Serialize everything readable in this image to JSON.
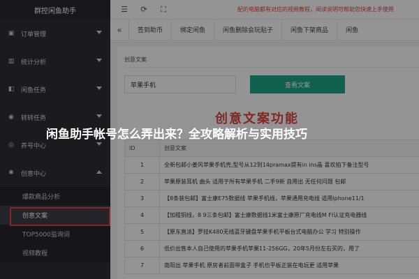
{
  "app": {
    "brand": "群控闲鱼助手"
  },
  "topbar": {
    "notice": "配的电脑都有对应的视频教程，阅读说明可帮助您快速上手使用"
  },
  "sidebar": {
    "items": [
      {
        "label": "订单管理",
        "icon": "order-icon"
      },
      {
        "label": "统计分析",
        "icon": "chart-icon"
      },
      {
        "label": "闲鱼任务",
        "icon": "task-icon"
      },
      {
        "label": "转转任务",
        "icon": "transfer-icon"
      },
      {
        "label": "养号中心",
        "icon": "account-icon"
      },
      {
        "label": "创意中心",
        "icon": "idea-icon"
      }
    ],
    "sub_items": [
      {
        "label": "爆款商品分析",
        "active": false
      },
      {
        "label": "创意文案",
        "active": true
      },
      {
        "label": "TOP5000监询词",
        "active": false
      },
      {
        "label": "视频教程",
        "active": false
      }
    ]
  },
  "tabs": [
    "签到助币",
    "绑定闲鱼",
    "闲鱼删除会玩贴子",
    "闲鱼下架商品",
    "闲鱼"
  ],
  "content": {
    "section_title": "创意文案",
    "keyword_value": "苹果手机",
    "query_button": "查看文案",
    "big_title": "创意文案功能",
    "table": {
      "headers": [
        "ID",
        "创意文案"
      ],
      "rows": [
        {
          "id": "1",
          "text": "全新包邮小姜风苹果手机壳,型号从12到14pramax提有in ins晶 喜欢拍下备注型号"
        },
        {
          "id": "2",
          "text": "苹果原装耳机 曲头 适用于所有苹果手机 二手9新 自用出 无任何问题 包邮"
        },
        {
          "id": "3",
          "text": "【8条装包邮】富士康E75数据线 苹果手机线，苹果通用充电线 适用iphone11/1"
        },
        {
          "id": "4",
          "text": "【加粗铜线，8 9三条包邮】富士康数据线1米富士康原厂充电线M FI认证充电器线"
        },
        {
          "id": "5",
          "text": "【原东直派】罗技K480无线蓝牙键盘苹果手机平板台式电脑办公 学习 特别操作"
        },
        {
          "id": "6",
          "text": "低价出售本人自己使用的苹果手机苹果11-256GG，20年5月份左右买的，用了"
        },
        {
          "id": "7",
          "text": "南阳出 苹果手机 原房者前面带盒子 手机也平板正装在电玩更 适用苹果"
        }
      ]
    }
  },
  "overlay": {
    "title": "闲鱼助手帐号怎么弄出来？全攻略解析与实用技巧"
  }
}
